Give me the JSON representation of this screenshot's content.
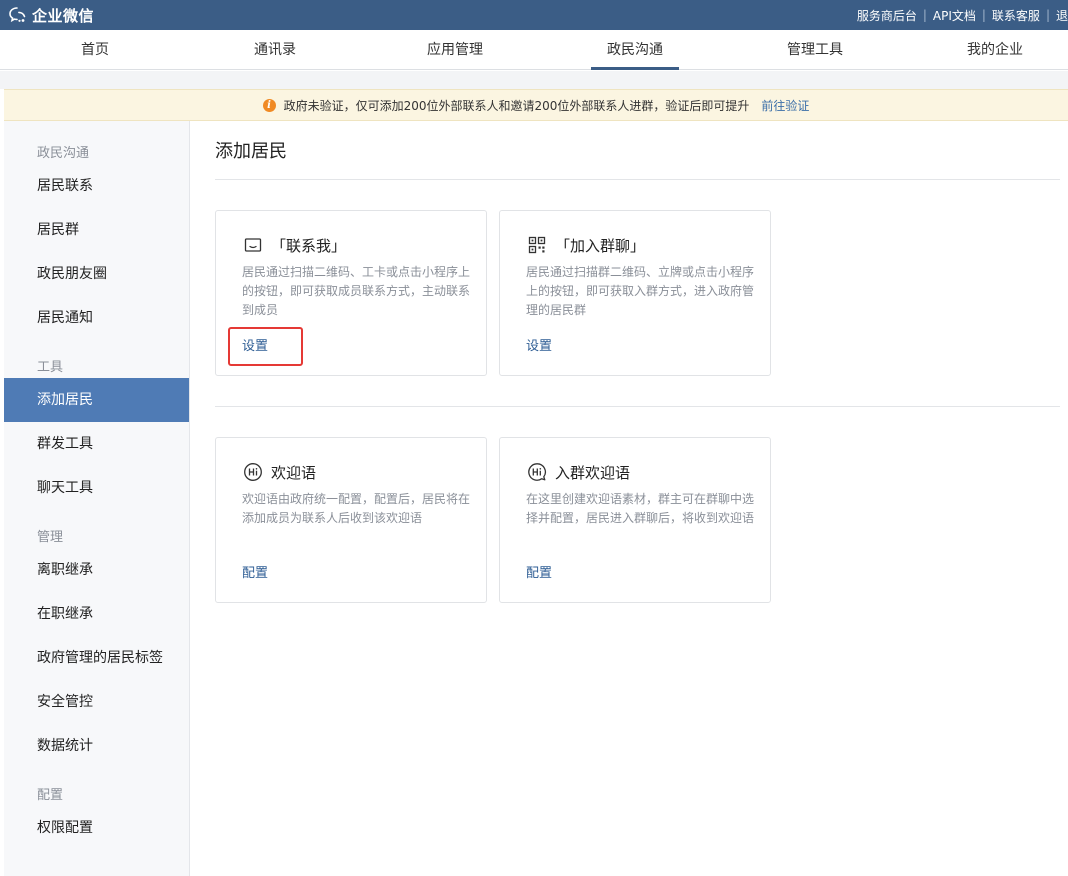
{
  "topbar": {
    "logo_text": "企业微信",
    "links": [
      "服务商后台",
      "API文档",
      "联系客服",
      "退"
    ]
  },
  "nav": {
    "tabs": [
      "首页",
      "通讯录",
      "应用管理",
      "政民沟通",
      "管理工具",
      "我的企业"
    ],
    "active": "政民沟通"
  },
  "notice": {
    "text": "政府未验证，仅可添加200位外部联系人和邀请200位外部联系人进群，验证后即可提升",
    "link": "前往验证"
  },
  "sidebar": {
    "groups": [
      {
        "label": "政民沟通",
        "items": [
          "居民联系",
          "居民群",
          "政民朋友圈",
          "居民通知"
        ]
      },
      {
        "label": "工具",
        "items": [
          "添加居民",
          "群发工具",
          "聊天工具"
        ]
      },
      {
        "label": "管理",
        "items": [
          "离职继承",
          "在职继承",
          "政府管理的居民标签",
          "安全管控",
          "数据统计"
        ]
      },
      {
        "label": "配置",
        "items": [
          "权限配置"
        ]
      }
    ],
    "active": "添加居民"
  },
  "content": {
    "title": "添加居民",
    "cards": [
      {
        "icon": "contact-me-icon",
        "title": "「联系我」",
        "desc": "居民通过扫描二维码、工卡或点击小程序上的按钮，即可获取成员联系方式，主动联系到成员",
        "action": "设置"
      },
      {
        "icon": "qrcode-icon",
        "title": "「加入群聊」",
        "desc": "居民通过扫描群二维码、立牌或点击小程序上的按钮，即可获取入群方式，进入政府管理的居民群",
        "action": "设置"
      },
      {
        "icon": "hi-icon",
        "title": "欢迎语",
        "desc": "欢迎语由政府统一配置，配置后，居民将在添加成员为联系人后收到该欢迎语",
        "action": "配置"
      },
      {
        "icon": "hi-chat-icon",
        "title": "入群欢迎语",
        "desc": "在这里创建欢迎语素材，群主可在群聊中选择并配置，居民进入群聊后，将收到欢迎语",
        "action": "配置"
      }
    ]
  },
  "colors": {
    "topbar": "#3b5d86",
    "sidebar_active": "#4f7bb5",
    "link": "#2e5d94",
    "highlight": "#e53935",
    "notice_bg": "#fbf5e1"
  }
}
